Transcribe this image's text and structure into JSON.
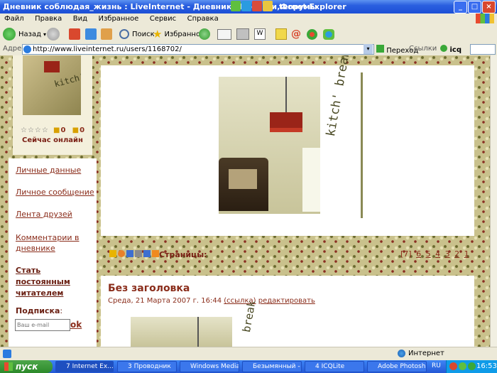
{
  "window": {
    "title_left": "Дневник соблюдая_жизнь : LiveInternet - Дневники,Новости,Форумы",
    "title_right": "ternet Explorer",
    "buttons": [
      "_",
      "□",
      "×"
    ]
  },
  "menubar": {
    "items": [
      "Файл",
      "Правка",
      "Вид",
      "Избранное",
      "Сервис",
      "Справка"
    ]
  },
  "toolbar": {
    "back_label": "Назад",
    "search_label": "Поиск",
    "favorites_label": "Избранное",
    "icq_label": "icq"
  },
  "addressbar": {
    "label": "Адрес:",
    "url": "http://www.liveinternet.ru/users/1168702/",
    "go_label": "Переход",
    "links_label": "Ссылки"
  },
  "sidebar": {
    "ratings_text": "☆☆☆☆",
    "counter_a": "0",
    "counter_b": "0",
    "online_label": "Сейчас онлайн",
    "items": [
      {
        "label": "Личные данные"
      },
      {
        "label": "Личное сообщение"
      },
      {
        "label": "Лента друзей"
      },
      {
        "label": "Комментарии в дневнике"
      },
      {
        "label": "Стать постоянным читателем"
      }
    ],
    "subscribe_label": "Подписка",
    "subscribe_colon": ":",
    "email_placeholder": "Ваш e-mail",
    "ok_label": "ok"
  },
  "header": {
    "brand_text": "kitch' break",
    "avatar_text": "kitch'"
  },
  "pager": {
    "label": "Страницы:",
    "pages": [
      "[7]",
      "6",
      "5",
      "4",
      "3",
      "2",
      "1"
    ]
  },
  "post": {
    "title": "Без заголовка",
    "meta_date": "Среда, 21 Марта 2007 г. 16:44",
    "meta_link": "(ссылка)",
    "meta_edit": "редактировать",
    "preview_text": "break"
  },
  "statusbar": {
    "zone": "Интернет"
  },
  "taskbar": {
    "start_label": "пуск",
    "buttons": [
      {
        "label": "7 Internet Ex..."
      },
      {
        "label": "3 Проводник"
      },
      {
        "label": "Windows Media..."
      },
      {
        "label": "Безымянный - ..."
      },
      {
        "label": "4 ICQLite"
      },
      {
        "label": "Adobe Photosh..."
      }
    ],
    "lang": "RU",
    "time": "16:53"
  },
  "colors": {
    "accent": "#8a2c1a",
    "xp_blue": "#2458d6",
    "page_bg": "#c9c18c"
  }
}
